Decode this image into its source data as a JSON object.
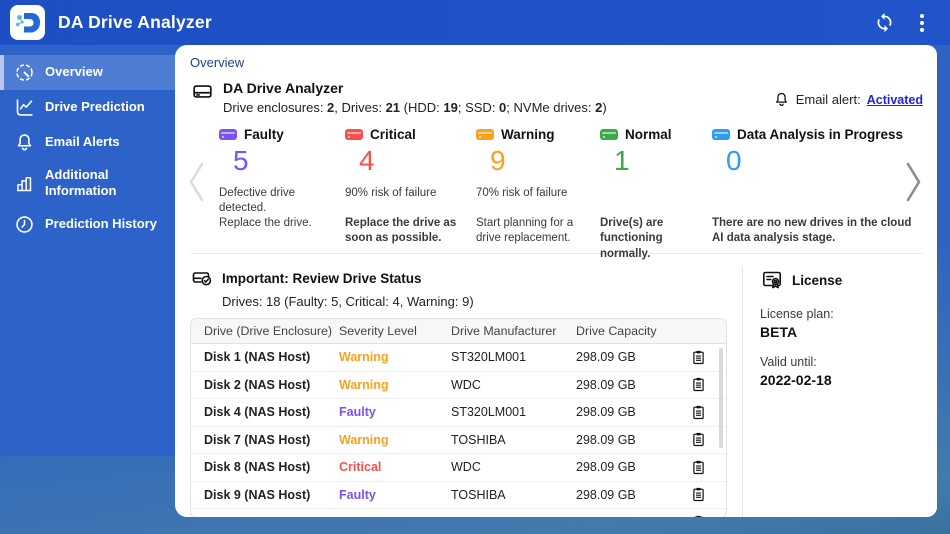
{
  "colors": {
    "header_blue": "#1f51c6",
    "sidebar_blue": "#2d63c9",
    "faulty": "#7b52f3",
    "critical": "#f4514c",
    "warning": "#f9a21b",
    "normal": "#3caa47",
    "analysis": "#2e9cf0",
    "link": "#2024dd"
  },
  "icons": {
    "logo": "da-drive-analyzer-logo",
    "refresh": "sync-circular-arrows",
    "menu": "kebab-three-dots",
    "overview": "gauge",
    "drive_prediction": "trend-line-chart",
    "email_alerts": "bell",
    "additional_information": "bar-chart",
    "prediction_history": "clock",
    "summary": "hard-drive",
    "email_alert": "bell",
    "drive_status": "hard-drive-check",
    "license": "certificate",
    "row_action": "clipboard",
    "carousel": "chevrons"
  },
  "app": {
    "title": "DA Drive Analyzer"
  },
  "sidebar": {
    "items": [
      {
        "label": "Overview"
      },
      {
        "label": "Drive Prediction"
      },
      {
        "label": "Email Alerts"
      },
      {
        "label": "Additional Information"
      },
      {
        "label": "Prediction History"
      }
    ]
  },
  "main": {
    "breadcrumb": "Overview",
    "summary": {
      "title": "DA Drive Analyzer",
      "parts": [
        "Drive enclosures: ",
        "2",
        ", Drives: ",
        "21",
        " (HDD: ",
        "19",
        "; SSD: ",
        "0",
        "; NVMe drives: ",
        "2",
        ")"
      ]
    },
    "email_alert": {
      "label": "Email alert:",
      "link": "Activated"
    }
  },
  "cards": [
    {
      "label": "Faulty",
      "count": "5",
      "color": "#7b52f3",
      "desc1": "Defective drive detected.",
      "desc2": "Replace the drive."
    },
    {
      "label": "Critical",
      "count": "4",
      "color": "#f4514c",
      "desc1": "90% risk of failure",
      "desc2": "Replace the drive as soon as possible."
    },
    {
      "label": "Warning",
      "count": "9",
      "color": "#f9a21b",
      "desc1": "70% risk of failure",
      "desc2": "Start planning for a drive replacement."
    },
    {
      "label": "Normal",
      "count": "1",
      "color": "#3caa47",
      "desc1": "",
      "desc2": "Drive(s) are functioning normally."
    },
    {
      "label": "Data Analysis in Progress",
      "count": "0",
      "color": "#2e9cf0",
      "desc1": "",
      "desc2": "There are no new drives in the cloud AI data analysis stage."
    }
  ],
  "drive_status": {
    "title": "Important: Review Drive Status",
    "subtitle": "Drives: 18 (Faulty: 5, Critical: 4, Warning: 9)",
    "columns": [
      "Drive (Drive Enclosure)",
      "Severity Level",
      "Drive Manufacturer",
      "Drive Capacity"
    ],
    "rows": [
      {
        "drive": "Disk 1 (NAS Host)",
        "severity": "Warning",
        "severity_color": "#f9a21b",
        "manufacturer": "ST320LM001",
        "capacity": "298.09 GB"
      },
      {
        "drive": "Disk 2 (NAS Host)",
        "severity": "Warning",
        "severity_color": "#f9a21b",
        "manufacturer": "WDC",
        "capacity": "298.09 GB"
      },
      {
        "drive": "Disk 4 (NAS Host)",
        "severity": "Faulty",
        "severity_color": "#7b52f3",
        "manufacturer": "ST320LM001",
        "capacity": "298.09 GB"
      },
      {
        "drive": "Disk 7 (NAS Host)",
        "severity": "Warning",
        "severity_color": "#f9a21b",
        "manufacturer": "TOSHIBA",
        "capacity": "298.09 GB"
      },
      {
        "drive": "Disk 8 (NAS Host)",
        "severity": "Critical",
        "severity_color": "#f4514c",
        "manufacturer": "WDC",
        "capacity": "298.09 GB"
      },
      {
        "drive": "Disk 9 (NAS Host)",
        "severity": "Faulty",
        "severity_color": "#7b52f3",
        "manufacturer": "TOSHIBA",
        "capacity": "298.09 GB"
      }
    ]
  },
  "license": {
    "title": "License",
    "plan_label": "License plan:",
    "plan": "BETA",
    "valid_label": "Valid until:",
    "valid": "2022-02-18"
  }
}
